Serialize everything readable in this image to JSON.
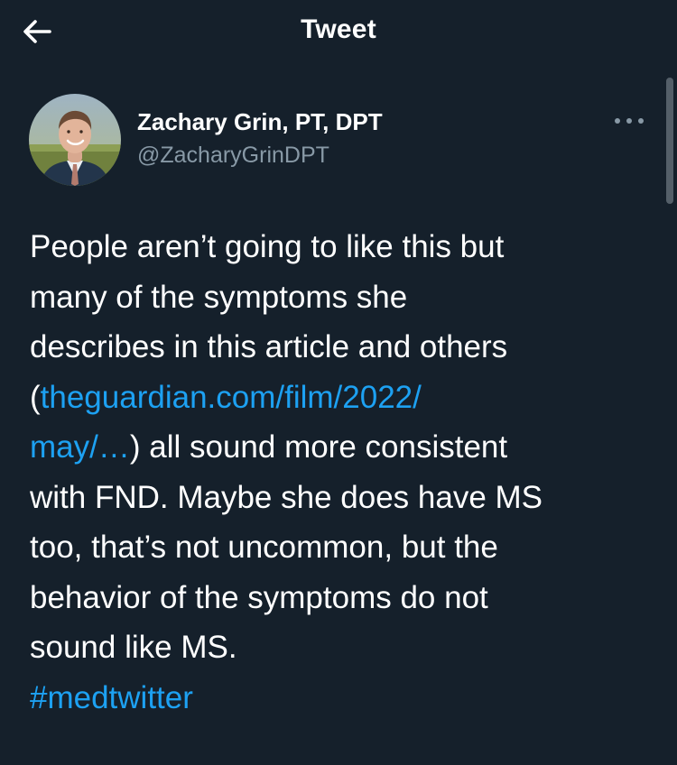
{
  "header": {
    "title": "Tweet",
    "back_icon": "left-arrow-icon"
  },
  "author": {
    "name": "Zachary Grin, PT, DPT",
    "handle": "@ZacharyGrinDPT",
    "avatar_icon": "avatar-photo"
  },
  "tweet": {
    "line1": "People aren’t going to like this but",
    "line2": "many of the symptoms she",
    "line3": "describes in this article and others",
    "line4_prefix": "(",
    "line4_link": "theguardian.com/film/2022/",
    "line5_link": "may/…",
    "line5_text": ") all sound more consistent",
    "line6": "with FND. Maybe she does have MS",
    "line7": "too, that’s not uncommon, but the",
    "line8": "behavior of the symptoms do not",
    "line9": "sound like MS.",
    "hashtag": "#medtwitter"
  },
  "colors": {
    "background": "#15202b",
    "text": "#ffffff",
    "secondary": "#8899a6",
    "link": "#1da1f2"
  },
  "more_icon": "ellipsis-horizontal-icon"
}
